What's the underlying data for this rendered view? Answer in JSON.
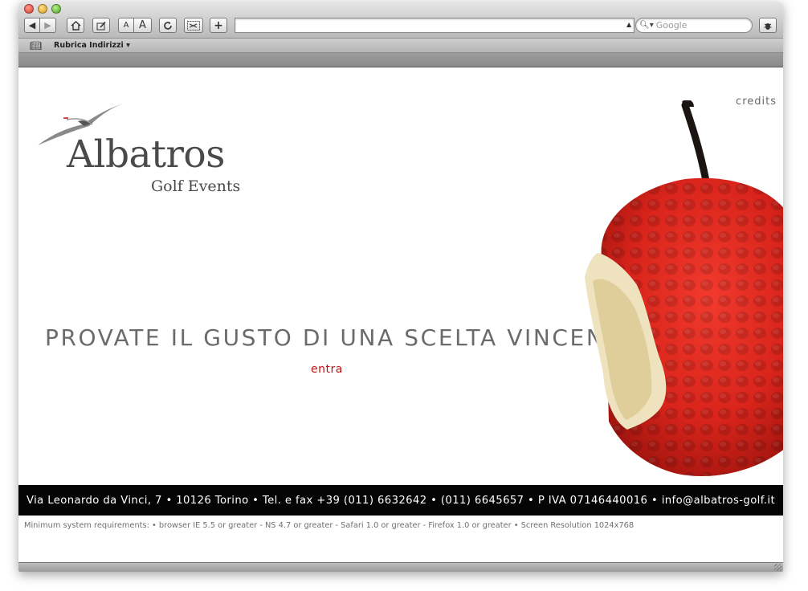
{
  "browser": {
    "search_placeholder": "Google",
    "bookmark_item": "Rubrica Indirizzi",
    "toolbar": {
      "font_small": "A",
      "font_large": "A",
      "add": "+"
    }
  },
  "page": {
    "credits": "credits",
    "logo_name": "Albatros",
    "logo_sub": "Golf Events",
    "tagline": "PROVATE IL GUSTO DI UNA SCELTA VINCENTE",
    "entra": "entra",
    "footer": "Via Leonardo da Vinci, 7 • 10126 Torino • Tel. e fax +39 (011) 6632642 • (011) 6645657 • P IVA 07146440016 • info@albatros-golf.it",
    "requirements": "Minimum system requirements: • browser IE 5.5 or greater - NS 4.7 or greater - Safari 1.0 or greater  - Firefox 1.0  or greater  • Screen Resolution 1024x768"
  },
  "colors": {
    "accent_red": "#c01010",
    "footer_bg": "#050505",
    "logo_gray": "#4a4a4a"
  }
}
